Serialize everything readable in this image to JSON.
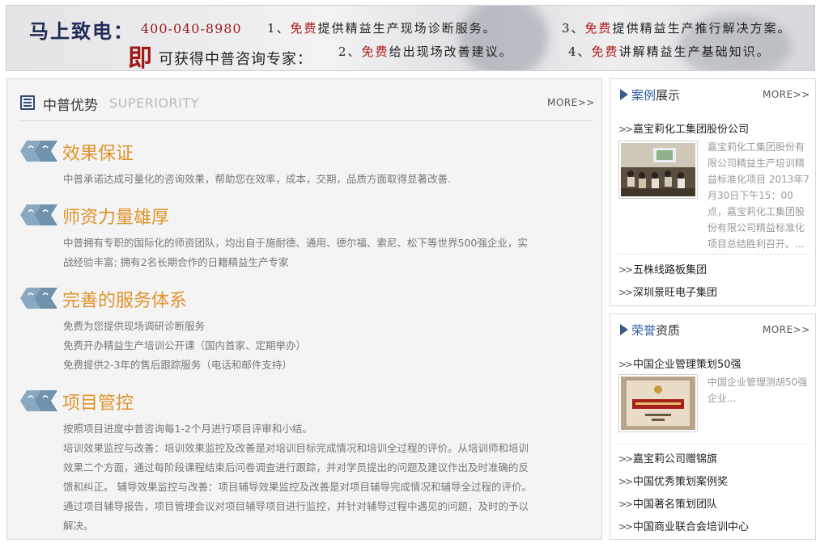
{
  "banner": {
    "brand": "马上致电：",
    "phone": "400-040-8980",
    "ji": "即",
    "ji_sub": "可获得中普咨询专家：",
    "items": [
      {
        "num": "1、",
        "free": "免费",
        "text": "提供精益生产现场诊断服务。"
      },
      {
        "num": "2、",
        "free": "免费",
        "text": "给出现场改善建议。"
      },
      {
        "num": "3、",
        "free": "免费",
        "text": "提供精益生产推行解决方案。"
      },
      {
        "num": "4、",
        "free": "免费",
        "text": "讲解精益生产基础知识。"
      }
    ]
  },
  "advantages": {
    "title": "中普优势",
    "title_en": "SUPERIORITY",
    "more": "MORE>>",
    "icon": "double-chevron-icon",
    "accent": "#e0922a",
    "items": [
      {
        "title": "效果保证",
        "lines": [
          "中普承诺达成可量化的咨询效果，帮助您在效率，成本，交期，品质方面取得显著改善."
        ]
      },
      {
        "title": "师资力量雄厚",
        "lines": [
          "中普拥有专职的国际化的师资团队，均出自于施耐德、通用、德尔福、索尼、松下等世界500强企业，实",
          "战经验丰富; 拥有2名长期合作的日籍精益生产专家"
        ]
      },
      {
        "title": "完善的服务体系",
        "lines": [
          "免费为您提供现场调研诊断服务",
          "免费开办精益生产培训公开课（国内首家、定期举办）",
          "免费提供2-3年的售后跟踪服务（电话和邮件支持）"
        ]
      },
      {
        "title": "项目管控",
        "lines": [
          "按照项目进度中普咨询每1-2个月进行项目评审和小结。",
          "培训效果监控与改善：培训效果监控及改善是对培训目标完成情况和培训全过程的评价。从培训师和培训",
          "效果二个方面，通过每阶段课程结束后问卷调查进行跟踪，并对学员提出的问题及建议作出及时准确的反",
          "馈和纠正。 辅导效果监控与改善：项目辅导效果监控及改善是对项目辅导完成情况和辅导全过程的评价。",
          "通过项目辅导报告，项目管理会议对项目辅导项目进行监控，并针对辅导过程中遇见的问题，及时的予以",
          "解决。"
        ]
      }
    ]
  },
  "cases": {
    "title_hl": "案例",
    "title_rest": "展示",
    "more": "MORE>>",
    "featured": {
      "name": "嘉宝莉化工集团股份公司",
      "desc": "嘉宝莉化工集团股份有限公司精益生产培训精益标准化项目 2013年7月30日下午15：00点，嘉宝莉化工集团股份有限公司精益标准化项目总结胜利召开。..."
    },
    "items": [
      "五株线路板集团",
      "深圳景旺电子集团"
    ]
  },
  "honors": {
    "title_hl": "荣誉",
    "title_rest": "资质",
    "more": "MORE>>",
    "featured": {
      "name": "中国企业管理策划50强",
      "desc": "中国企业管理测胡50强企业..."
    },
    "items": [
      "嘉宝莉公司赠锦旗",
      "中国优秀策划案例奖",
      "中国著名策划团队",
      "中国商业联合会培训中心"
    ]
  }
}
